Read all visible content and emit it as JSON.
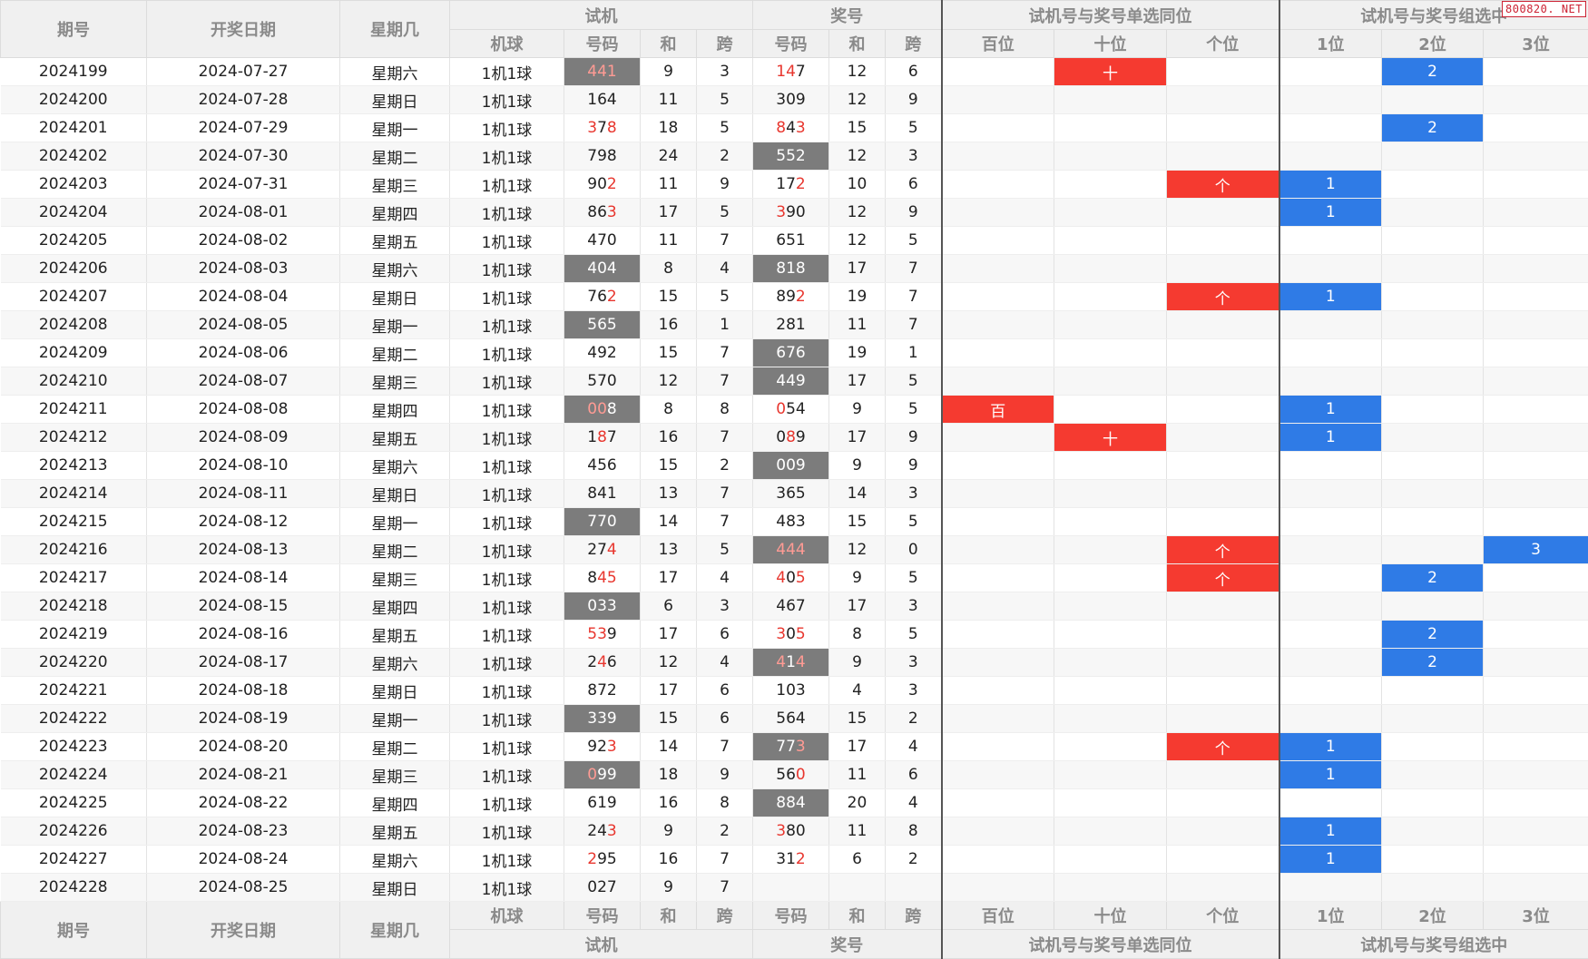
{
  "watermark": "800820. NET",
  "header": {
    "col_issue": "期号",
    "col_date": "开奖日期",
    "col_weekday": "星期几",
    "group_trial": "试机",
    "group_prize": "奖号",
    "group_single": "试机号与奖号单选同位",
    "group_combo": "试机号与奖号组选中",
    "sub_machine": "机球",
    "sub_num": "号码",
    "sub_sum": "和",
    "sub_span": "跨",
    "sub_hundreds": "百位",
    "sub_tens": "十位",
    "sub_units": "个位",
    "sub_pos1": "1位",
    "sub_pos2": "2位",
    "sub_pos3": "3位"
  },
  "colors": {
    "highlight_red": "#f53a30",
    "highlight_blue": "#2f7be6",
    "gray_cell": "#7c7c7c",
    "digit_red": "#e8362e"
  },
  "rows": [
    {
      "issue": "2024199",
      "date": "2024-07-27",
      "weekday": "星期六",
      "machine": "1机1球",
      "trial": "441",
      "trial_red": [
        0,
        1,
        2
      ],
      "trial_gray": true,
      "trial_sum": "9",
      "trial_span": "3",
      "prize": "147",
      "prize_red": [
        0,
        1
      ],
      "prize_gray": false,
      "prize_sum": "12",
      "prize_span": "6",
      "single": [
        "",
        "十",
        ""
      ],
      "combo": [
        "",
        "2",
        ""
      ]
    },
    {
      "issue": "2024200",
      "date": "2024-07-28",
      "weekday": "星期日",
      "machine": "1机1球",
      "trial": "164",
      "trial_red": [],
      "trial_gray": false,
      "trial_sum": "11",
      "trial_span": "5",
      "prize": "309",
      "prize_red": [],
      "prize_gray": false,
      "prize_sum": "12",
      "prize_span": "9",
      "single": [
        "",
        "",
        ""
      ],
      "combo": [
        "",
        "",
        ""
      ]
    },
    {
      "issue": "2024201",
      "date": "2024-07-29",
      "weekday": "星期一",
      "machine": "1机1球",
      "trial": "378",
      "trial_red": [
        0,
        2
      ],
      "trial_gray": false,
      "trial_sum": "18",
      "trial_span": "5",
      "prize": "843",
      "prize_red": [
        0,
        2
      ],
      "prize_gray": false,
      "prize_sum": "15",
      "prize_span": "5",
      "single": [
        "",
        "",
        ""
      ],
      "combo": [
        "",
        "2",
        ""
      ]
    },
    {
      "issue": "2024202",
      "date": "2024-07-30",
      "weekday": "星期二",
      "machine": "1机1球",
      "trial": "798",
      "trial_red": [],
      "trial_gray": false,
      "trial_sum": "24",
      "trial_span": "2",
      "prize": "552",
      "prize_red": [],
      "prize_gray": true,
      "prize_sum": "12",
      "prize_span": "3",
      "single": [
        "",
        "",
        ""
      ],
      "combo": [
        "",
        "",
        ""
      ]
    },
    {
      "issue": "2024203",
      "date": "2024-07-31",
      "weekday": "星期三",
      "machine": "1机1球",
      "trial": "902",
      "trial_red": [
        2
      ],
      "trial_gray": false,
      "trial_sum": "11",
      "trial_span": "9",
      "prize": "172",
      "prize_red": [
        2
      ],
      "prize_gray": false,
      "prize_sum": "10",
      "prize_span": "6",
      "single": [
        "",
        "",
        "个"
      ],
      "combo": [
        "1",
        "",
        ""
      ]
    },
    {
      "issue": "2024204",
      "date": "2024-08-01",
      "weekday": "星期四",
      "machine": "1机1球",
      "trial": "863",
      "trial_red": [
        2
      ],
      "trial_gray": false,
      "trial_sum": "17",
      "trial_span": "5",
      "prize": "390",
      "prize_red": [
        0
      ],
      "prize_gray": false,
      "prize_sum": "12",
      "prize_span": "9",
      "single": [
        "",
        "",
        ""
      ],
      "combo": [
        "1",
        "",
        ""
      ]
    },
    {
      "issue": "2024205",
      "date": "2024-08-02",
      "weekday": "星期五",
      "machine": "1机1球",
      "trial": "470",
      "trial_red": [],
      "trial_gray": false,
      "trial_sum": "11",
      "trial_span": "7",
      "prize": "651",
      "prize_red": [],
      "prize_gray": false,
      "prize_sum": "12",
      "prize_span": "5",
      "single": [
        "",
        "",
        ""
      ],
      "combo": [
        "",
        "",
        ""
      ]
    },
    {
      "issue": "2024206",
      "date": "2024-08-03",
      "weekday": "星期六",
      "machine": "1机1球",
      "trial": "404",
      "trial_red": [],
      "trial_gray": true,
      "trial_sum": "8",
      "trial_span": "4",
      "prize": "818",
      "prize_red": [],
      "prize_gray": true,
      "prize_sum": "17",
      "prize_span": "7",
      "single": [
        "",
        "",
        ""
      ],
      "combo": [
        "",
        "",
        ""
      ]
    },
    {
      "issue": "2024207",
      "date": "2024-08-04",
      "weekday": "星期日",
      "machine": "1机1球",
      "trial": "762",
      "trial_red": [
        2
      ],
      "trial_gray": false,
      "trial_sum": "15",
      "trial_span": "5",
      "prize": "892",
      "prize_red": [
        2
      ],
      "prize_gray": false,
      "prize_sum": "19",
      "prize_span": "7",
      "single": [
        "",
        "",
        "个"
      ],
      "combo": [
        "1",
        "",
        ""
      ]
    },
    {
      "issue": "2024208",
      "date": "2024-08-05",
      "weekday": "星期一",
      "machine": "1机1球",
      "trial": "565",
      "trial_red": [],
      "trial_gray": true,
      "trial_sum": "16",
      "trial_span": "1",
      "prize": "281",
      "prize_red": [],
      "prize_gray": false,
      "prize_sum": "11",
      "prize_span": "7",
      "single": [
        "",
        "",
        ""
      ],
      "combo": [
        "",
        "",
        ""
      ]
    },
    {
      "issue": "2024209",
      "date": "2024-08-06",
      "weekday": "星期二",
      "machine": "1机1球",
      "trial": "492",
      "trial_red": [],
      "trial_gray": false,
      "trial_sum": "15",
      "trial_span": "7",
      "prize": "676",
      "prize_red": [],
      "prize_gray": true,
      "prize_sum": "19",
      "prize_span": "1",
      "single": [
        "",
        "",
        ""
      ],
      "combo": [
        "",
        "",
        ""
      ]
    },
    {
      "issue": "2024210",
      "date": "2024-08-07",
      "weekday": "星期三",
      "machine": "1机1球",
      "trial": "570",
      "trial_red": [],
      "trial_gray": false,
      "trial_sum": "12",
      "trial_span": "7",
      "prize": "449",
      "prize_red": [],
      "prize_gray": true,
      "prize_sum": "17",
      "prize_span": "5",
      "single": [
        "",
        "",
        ""
      ],
      "combo": [
        "",
        "",
        ""
      ]
    },
    {
      "issue": "2024211",
      "date": "2024-08-08",
      "weekday": "星期四",
      "machine": "1机1球",
      "trial": "008",
      "trial_red": [
        0,
        1
      ],
      "trial_gray": true,
      "trial_sum": "8",
      "trial_span": "8",
      "prize": "054",
      "prize_red": [
        0
      ],
      "prize_gray": false,
      "prize_sum": "9",
      "prize_span": "5",
      "single": [
        "百",
        "",
        ""
      ],
      "combo": [
        "1",
        "",
        ""
      ]
    },
    {
      "issue": "2024212",
      "date": "2024-08-09",
      "weekday": "星期五",
      "machine": "1机1球",
      "trial": "187",
      "trial_red": [
        1
      ],
      "trial_gray": false,
      "trial_sum": "16",
      "trial_span": "7",
      "prize": "089",
      "prize_red": [
        1
      ],
      "prize_gray": false,
      "prize_sum": "17",
      "prize_span": "9",
      "single": [
        "",
        "十",
        ""
      ],
      "combo": [
        "1",
        "",
        ""
      ]
    },
    {
      "issue": "2024213",
      "date": "2024-08-10",
      "weekday": "星期六",
      "machine": "1机1球",
      "trial": "456",
      "trial_red": [],
      "trial_gray": false,
      "trial_sum": "15",
      "trial_span": "2",
      "prize": "009",
      "prize_red": [],
      "prize_gray": true,
      "prize_sum": "9",
      "prize_span": "9",
      "single": [
        "",
        "",
        ""
      ],
      "combo": [
        "",
        "",
        ""
      ]
    },
    {
      "issue": "2024214",
      "date": "2024-08-11",
      "weekday": "星期日",
      "machine": "1机1球",
      "trial": "841",
      "trial_red": [],
      "trial_gray": false,
      "trial_sum": "13",
      "trial_span": "7",
      "prize": "365",
      "prize_red": [],
      "prize_gray": false,
      "prize_sum": "14",
      "prize_span": "3",
      "single": [
        "",
        "",
        ""
      ],
      "combo": [
        "",
        "",
        ""
      ]
    },
    {
      "issue": "2024215",
      "date": "2024-08-12",
      "weekday": "星期一",
      "machine": "1机1球",
      "trial": "770",
      "trial_red": [],
      "trial_gray": true,
      "trial_sum": "14",
      "trial_span": "7",
      "prize": "483",
      "prize_red": [],
      "prize_gray": false,
      "prize_sum": "15",
      "prize_span": "5",
      "single": [
        "",
        "",
        ""
      ],
      "combo": [
        "",
        "",
        ""
      ]
    },
    {
      "issue": "2024216",
      "date": "2024-08-13",
      "weekday": "星期二",
      "machine": "1机1球",
      "trial": "274",
      "trial_red": [
        2
      ],
      "trial_gray": false,
      "trial_sum": "13",
      "trial_span": "5",
      "prize": "444",
      "prize_red": [
        0,
        1,
        2
      ],
      "prize_gray": true,
      "prize_sum": "12",
      "prize_span": "0",
      "single": [
        "",
        "",
        "个"
      ],
      "combo": [
        "",
        "",
        "3"
      ]
    },
    {
      "issue": "2024217",
      "date": "2024-08-14",
      "weekday": "星期三",
      "machine": "1机1球",
      "trial": "845",
      "trial_red": [
        1,
        2
      ],
      "trial_gray": false,
      "trial_sum": "17",
      "trial_span": "4",
      "prize": "405",
      "prize_red": [
        0,
        2
      ],
      "prize_gray": false,
      "prize_sum": "9",
      "prize_span": "5",
      "single": [
        "",
        "",
        "个"
      ],
      "combo": [
        "",
        "2",
        ""
      ]
    },
    {
      "issue": "2024218",
      "date": "2024-08-15",
      "weekday": "星期四",
      "machine": "1机1球",
      "trial": "033",
      "trial_red": [],
      "trial_gray": true,
      "trial_sum": "6",
      "trial_span": "3",
      "prize": "467",
      "prize_red": [],
      "prize_gray": false,
      "prize_sum": "17",
      "prize_span": "3",
      "single": [
        "",
        "",
        ""
      ],
      "combo": [
        "",
        "",
        ""
      ]
    },
    {
      "issue": "2024219",
      "date": "2024-08-16",
      "weekday": "星期五",
      "machine": "1机1球",
      "trial": "539",
      "trial_red": [
        0,
        1
      ],
      "trial_gray": false,
      "trial_sum": "17",
      "trial_span": "6",
      "prize": "305",
      "prize_red": [
        0,
        2
      ],
      "prize_gray": false,
      "prize_sum": "8",
      "prize_span": "5",
      "single": [
        "",
        "",
        ""
      ],
      "combo": [
        "",
        "2",
        ""
      ]
    },
    {
      "issue": "2024220",
      "date": "2024-08-17",
      "weekday": "星期六",
      "machine": "1机1球",
      "trial": "246",
      "trial_red": [
        1
      ],
      "trial_gray": false,
      "trial_sum": "12",
      "trial_span": "4",
      "prize": "414",
      "prize_red": [
        0,
        2
      ],
      "prize_gray": true,
      "prize_sum": "9",
      "prize_span": "3",
      "single": [
        "",
        "",
        ""
      ],
      "combo": [
        "",
        "2",
        ""
      ]
    },
    {
      "issue": "2024221",
      "date": "2024-08-18",
      "weekday": "星期日",
      "machine": "1机1球",
      "trial": "872",
      "trial_red": [],
      "trial_gray": false,
      "trial_sum": "17",
      "trial_span": "6",
      "prize": "103",
      "prize_red": [],
      "prize_gray": false,
      "prize_sum": "4",
      "prize_span": "3",
      "single": [
        "",
        "",
        ""
      ],
      "combo": [
        "",
        "",
        ""
      ]
    },
    {
      "issue": "2024222",
      "date": "2024-08-19",
      "weekday": "星期一",
      "machine": "1机1球",
      "trial": "339",
      "trial_red": [],
      "trial_gray": true,
      "trial_sum": "15",
      "trial_span": "6",
      "prize": "564",
      "prize_red": [],
      "prize_gray": false,
      "prize_sum": "15",
      "prize_span": "2",
      "single": [
        "",
        "",
        ""
      ],
      "combo": [
        "",
        "",
        ""
      ]
    },
    {
      "issue": "2024223",
      "date": "2024-08-20",
      "weekday": "星期二",
      "machine": "1机1球",
      "trial": "923",
      "trial_red": [
        2
      ],
      "trial_gray": false,
      "trial_sum": "14",
      "trial_span": "7",
      "prize": "773",
      "prize_red": [
        2
      ],
      "prize_gray": true,
      "prize_sum": "17",
      "prize_span": "4",
      "single": [
        "",
        "",
        "个"
      ],
      "combo": [
        "1",
        "",
        ""
      ]
    },
    {
      "issue": "2024224",
      "date": "2024-08-21",
      "weekday": "星期三",
      "machine": "1机1球",
      "trial": "099",
      "trial_red": [
        0
      ],
      "trial_gray": true,
      "trial_sum": "18",
      "trial_span": "9",
      "prize": "560",
      "prize_red": [
        2
      ],
      "prize_gray": false,
      "prize_sum": "11",
      "prize_span": "6",
      "single": [
        "",
        "",
        ""
      ],
      "combo": [
        "1",
        "",
        ""
      ]
    },
    {
      "issue": "2024225",
      "date": "2024-08-22",
      "weekday": "星期四",
      "machine": "1机1球",
      "trial": "619",
      "trial_red": [],
      "trial_gray": false,
      "trial_sum": "16",
      "trial_span": "8",
      "prize": "884",
      "prize_red": [],
      "prize_gray": true,
      "prize_sum": "20",
      "prize_span": "4",
      "single": [
        "",
        "",
        ""
      ],
      "combo": [
        "",
        "",
        ""
      ]
    },
    {
      "issue": "2024226",
      "date": "2024-08-23",
      "weekday": "星期五",
      "machine": "1机1球",
      "trial": "243",
      "trial_red": [
        2
      ],
      "trial_gray": false,
      "trial_sum": "9",
      "trial_span": "2",
      "prize": "380",
      "prize_red": [
        0
      ],
      "prize_gray": false,
      "prize_sum": "11",
      "prize_span": "8",
      "single": [
        "",
        "",
        ""
      ],
      "combo": [
        "1",
        "",
        ""
      ]
    },
    {
      "issue": "2024227",
      "date": "2024-08-24",
      "weekday": "星期六",
      "machine": "1机1球",
      "trial": "295",
      "trial_red": [
        0
      ],
      "trial_gray": false,
      "trial_sum": "16",
      "trial_span": "7",
      "prize": "312",
      "prize_red": [
        2
      ],
      "prize_gray": false,
      "prize_sum": "6",
      "prize_span": "2",
      "single": [
        "",
        "",
        ""
      ],
      "combo": [
        "1",
        "",
        ""
      ]
    },
    {
      "issue": "2024228",
      "date": "2024-08-25",
      "weekday": "星期日",
      "machine": "1机1球",
      "trial": "027",
      "trial_red": [],
      "trial_gray": false,
      "trial_sum": "9",
      "trial_span": "7",
      "prize": "",
      "prize_red": [],
      "prize_gray": false,
      "prize_sum": "",
      "prize_span": "",
      "single": [
        "",
        "",
        ""
      ],
      "combo": [
        "",
        "",
        ""
      ]
    }
  ]
}
